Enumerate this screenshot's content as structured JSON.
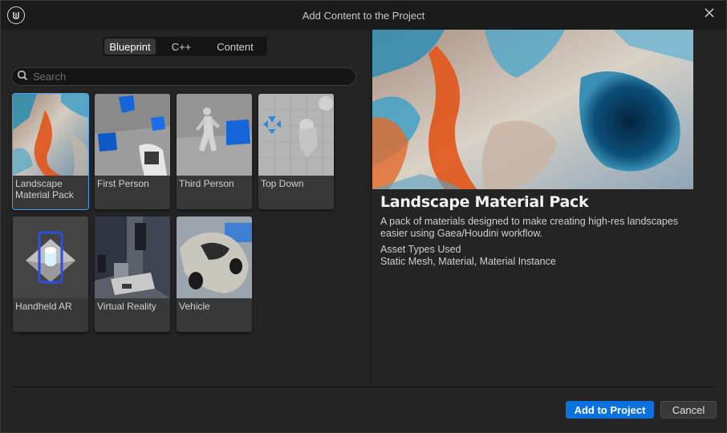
{
  "window": {
    "title": "Add Content to the Project"
  },
  "tabs": {
    "items": [
      {
        "label": "Blueprint",
        "active": true
      },
      {
        "label": "C++",
        "active": false
      },
      {
        "label": "Content",
        "active": false
      }
    ]
  },
  "search": {
    "placeholder": "Search",
    "value": ""
  },
  "templates": [
    {
      "label": "Landscape Material Pack",
      "selected": true,
      "thumbnail": "landscape-thumbnail"
    },
    {
      "label": "First Person",
      "selected": false,
      "thumbnail": "first-person-thumbnail"
    },
    {
      "label": "Third Person",
      "selected": false,
      "thumbnail": "third-person-thumbnail"
    },
    {
      "label": "Top Down",
      "selected": false,
      "thumbnail": "top-down-thumbnail"
    },
    {
      "label": "Handheld AR",
      "selected": false,
      "thumbnail": "handheld-ar-thumbnail"
    },
    {
      "label": "Virtual Reality",
      "selected": false,
      "thumbnail": "virtual-reality-thumbnail"
    },
    {
      "label": "Vehicle",
      "selected": false,
      "thumbnail": "vehicle-thumbnail"
    }
  ],
  "detail": {
    "title": "Landscape Material Pack",
    "description": "A pack of materials designed to make creating high-res landscapes easier using Gaea/Houdini workflow.",
    "asset_types_heading": "Asset Types Used",
    "asset_types": "Static Mesh, Material, Material Instance"
  },
  "footer": {
    "add_label": "Add to Project",
    "cancel_label": "Cancel"
  },
  "colors": {
    "accent": "#0b71df",
    "selection": "#4aa3f0",
    "panel": "#242424",
    "titlebar": "#1b1b1b"
  }
}
